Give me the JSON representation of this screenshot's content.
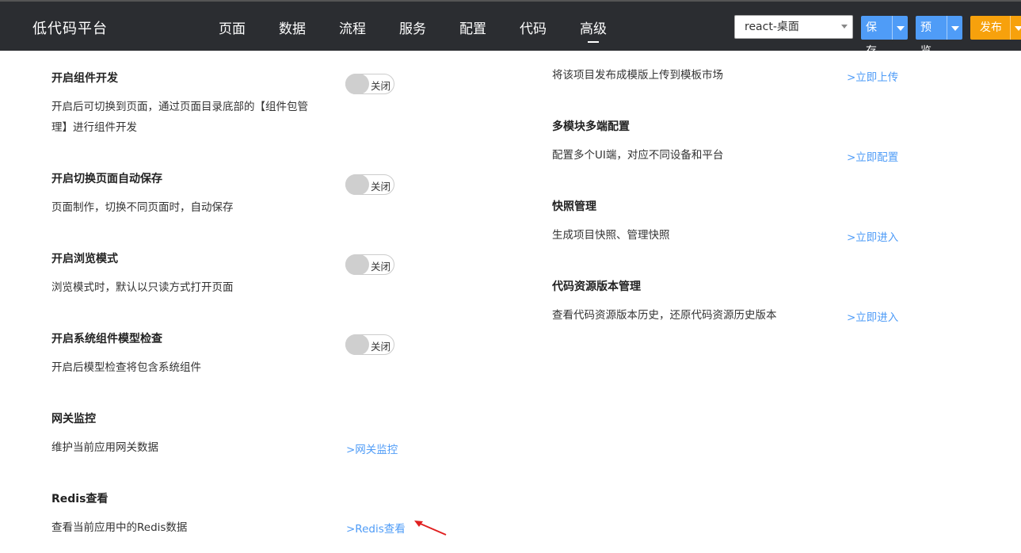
{
  "header": {
    "brand": "低代码平台",
    "nav": [
      "页面",
      "数据",
      "流程",
      "服务",
      "配置",
      "代码",
      "高级"
    ],
    "active_nav": "高级",
    "project_select": "react-桌面",
    "save_label": "保存",
    "preview_label": "预览",
    "publish_label": "发布"
  },
  "left": {
    "settings": [
      {
        "title": "开启组件开发",
        "desc_line1": "开启后可切换到页面，通过页面目录底部的【组件包管",
        "desc_line2": "理】进行组件开发",
        "toggle": "关闭"
      },
      {
        "title": "开启切换页面自动保存",
        "desc_line1": "页面制作，切换不同页面时，自动保存",
        "toggle": "关闭"
      },
      {
        "title": "开启浏览模式",
        "desc_line1": "浏览模式时，默认以只读方式打开页面",
        "toggle": "关闭"
      },
      {
        "title": "开启系统组件模型检查",
        "desc_line1": "开启后模型检查将包含系统组件",
        "toggle": "关闭"
      },
      {
        "title": "网关监控",
        "desc_line1": "维护当前应用网关数据",
        "link": ">网关监控"
      },
      {
        "title": "Redis查看",
        "desc_line1": "查看当前应用中的Redis数据",
        "link": ">Redis查看"
      }
    ]
  },
  "right": {
    "settings": [
      {
        "desc": "将该项目发布成模版上传到模板市场",
        "link": ">立即上传"
      },
      {
        "title": "多模块多端配置",
        "desc": "配置多个UI端，对应不同设备和平台",
        "link": ">立即配置"
      },
      {
        "title": "快照管理",
        "desc": "生成项目快照、管理快照",
        "link": ">立即进入"
      },
      {
        "title": "代码资源版本管理",
        "desc": "查看代码资源版本历史，还原代码资源历史版本",
        "link": ">立即进入"
      }
    ]
  },
  "colors": {
    "header_bg": "#2b2d31",
    "accent_blue": "#4f9cf7",
    "publish_orange": "#f7a10c",
    "annotation_red": "#e02020"
  }
}
